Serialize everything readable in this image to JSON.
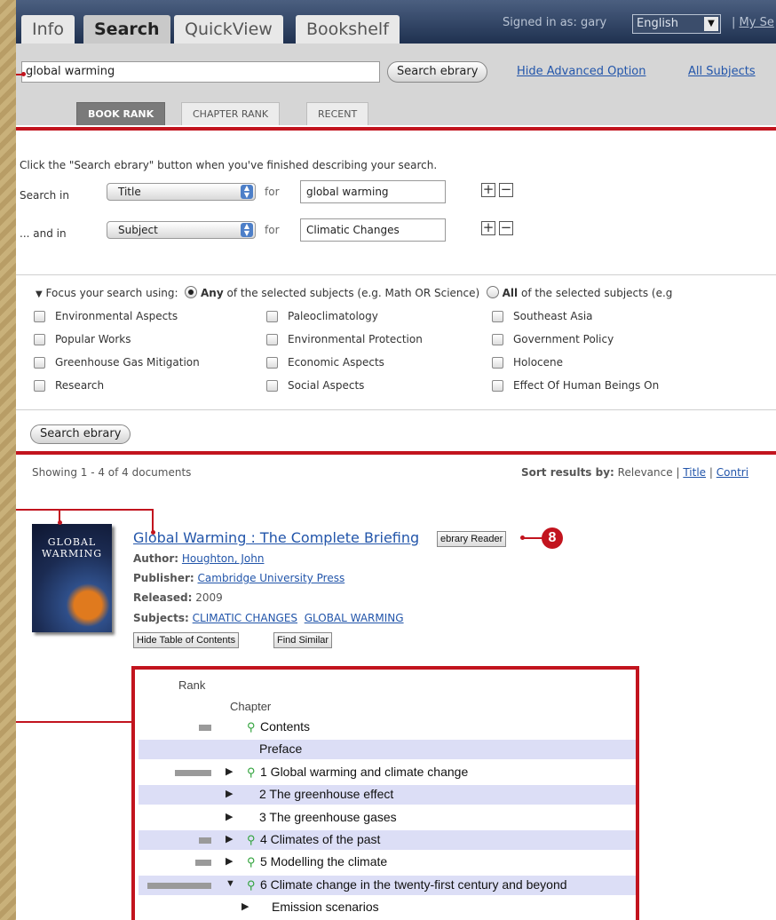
{
  "top_tabs": [
    {
      "label": "Info",
      "active": false
    },
    {
      "label": "Search",
      "active": true
    },
    {
      "label": "QuickView",
      "active": false
    },
    {
      "label": "Bookshelf",
      "active": false
    }
  ],
  "header": {
    "signed_in": "Signed in as: gary",
    "language": "English",
    "my_link": "My Se",
    "my_link_sep": "|"
  },
  "search": {
    "query": "global warming",
    "button": "Search ebrary",
    "hide_advanced": "Hide Advanced Option",
    "all_subjects": "All Subjects"
  },
  "rank_tabs": [
    {
      "label": "BOOK RANK",
      "active": true
    },
    {
      "label": "CHAPTER RANK",
      "active": false
    },
    {
      "label": "RECENT",
      "active": false
    }
  ],
  "advanced": {
    "instruction": "Click the \"Search ebrary\" button when you've finished describing your search.",
    "rows": [
      {
        "label": "Search in",
        "field": "Title",
        "for": "for",
        "value": "global warming"
      },
      {
        "label": "... and in",
        "field": "Subject",
        "for": "for",
        "value": "Climatic Changes"
      }
    ],
    "focus_prefix": "Focus your search using:",
    "focus_any_bold": "Any",
    "focus_any_rest": "of the selected subjects (e.g. Math OR Science)",
    "focus_all_bold": "All",
    "focus_all_rest": "of the selected subjects (e.g",
    "subjects": [
      [
        "Environmental Aspects",
        "Paleoclimatology",
        "Southeast Asia"
      ],
      [
        "Popular Works",
        "Environmental Protection",
        "Government Policy"
      ],
      [
        "Greenhouse Gas Mitigation",
        "Economic Aspects",
        "Holocene"
      ],
      [
        "Research",
        "Social Aspects",
        "Effect Of Human Beings On"
      ]
    ],
    "submit": "Search ebrary"
  },
  "results": {
    "showing": "Showing 1 - 4 of 4 documents",
    "sort_label": "Sort results by:",
    "sort_relevance": "Relevance",
    "sort_sep": "|",
    "sort_title": "Title",
    "sort_contrib": "Contri"
  },
  "book": {
    "cover_title_1": "GLOBAL",
    "cover_title_2": "WARMING",
    "title": "Global Warming : The Complete Briefing",
    "reader_btn": "ebrary Reader",
    "author_label": "Author:",
    "author": "Houghton, John",
    "publisher_label": "Publisher:",
    "publisher": "Cambridge University Press",
    "released_label": "Released:",
    "released": "2009",
    "subjects_label": "Subjects:",
    "subject_1": "CLIMATIC CHANGES",
    "subject_2": "GLOBAL WARMING",
    "hide_toc": "Hide Table of Contents",
    "find_similar": "Find Similar"
  },
  "callout_number": "8",
  "toc": {
    "rank_header": "Rank",
    "chapter_header": "Chapter",
    "rows": [
      {
        "label": "Contents",
        "rank": 0.15,
        "mag": true,
        "tri": "",
        "shade": false
      },
      {
        "label": "Preface",
        "rank": 0,
        "mag": false,
        "tri": "",
        "shade": true
      },
      {
        "label": "1 Global warming and climate change",
        "rank": 0.45,
        "mag": true,
        "tri": "right",
        "shade": false
      },
      {
        "label": "2 The greenhouse effect",
        "rank": 0,
        "mag": false,
        "tri": "right",
        "shade": true
      },
      {
        "label": "3 The greenhouse gases",
        "rank": 0,
        "mag": false,
        "tri": "right",
        "shade": false
      },
      {
        "label": "4 Climates of the past",
        "rank": 0.15,
        "mag": true,
        "tri": "right",
        "shade": true
      },
      {
        "label": "5 Modelling the climate",
        "rank": 0.2,
        "mag": true,
        "tri": "right",
        "shade": false
      },
      {
        "label": "6 Climate change in the twenty-first century and beyond",
        "rank": 0.8,
        "mag": true,
        "tri": "down",
        "shade": true
      },
      {
        "label": "Emission scenarios",
        "rank": 0,
        "mag": false,
        "tri": "right",
        "shade": false
      }
    ]
  },
  "colors": {
    "callout_red": "#c2141e",
    "link_blue": "#2255aa",
    "toc_shade": "#dcdef6",
    "search_magnifier": "#2fa23a"
  }
}
